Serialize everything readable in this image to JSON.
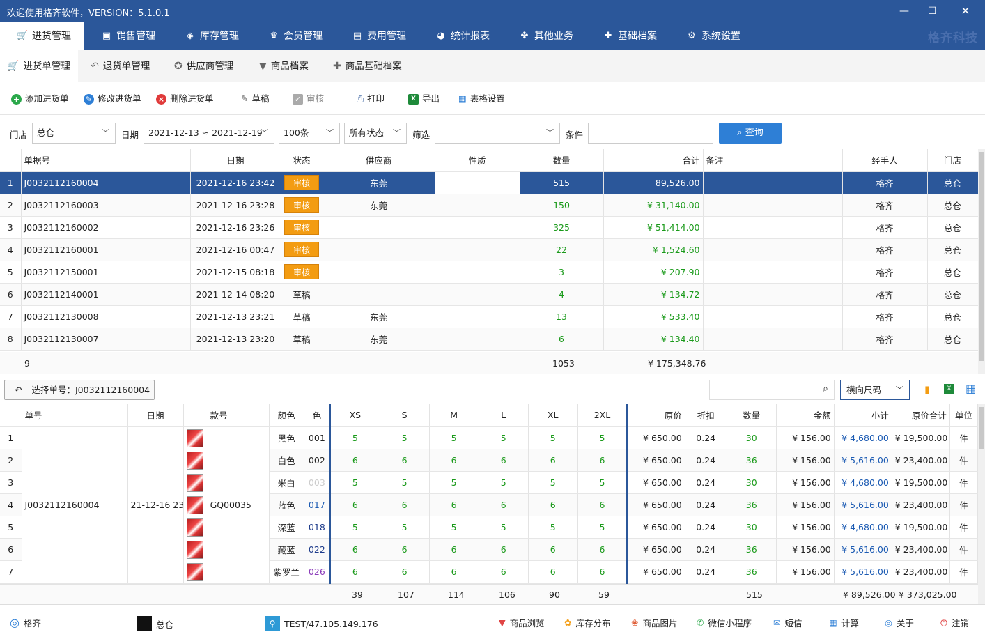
{
  "title": "欢迎使用格齐软件，VERSION：5.1.0.1",
  "brand": "格齐科技",
  "main_tabs": [
    "进货管理",
    "销售管理",
    "库存管理",
    "会员管理",
    "费用管理",
    "统计报表",
    "其他业务",
    "基础档案",
    "系统设置"
  ],
  "sub_tabs": [
    "进货单管理",
    "退货单管理",
    "供应商管理",
    "商品档案",
    "商品基础档案"
  ],
  "toolbar": [
    "添加进货单",
    "修改进货单",
    "删除进货单",
    "草稿",
    "审核",
    "打印",
    "导出",
    "表格设置"
  ],
  "filter": {
    "store_label": "门店",
    "store_value": "总仓",
    "date_label": "日期",
    "date_value": "2021-12-13 ≈ 2021-12-19",
    "count_value": "100条",
    "status_value": "所有状态",
    "screen_label": "筛选",
    "cond_label": "条件",
    "query_label": "查询"
  },
  "orders": {
    "headers": [
      "单据号",
      "日期",
      "状态",
      "供应商",
      "性质",
      "数量",
      "合计",
      "备注",
      "经手人",
      "门店"
    ],
    "rows": [
      {
        "n": "1",
        "no": "J0032112160004",
        "date": "2021-12-16 23:42",
        "status": "审核",
        "sup": "东莞",
        "qty": "515",
        "total": "89,526.00",
        "op": "格齐",
        "store": "总仓"
      },
      {
        "n": "2",
        "no": "J0032112160003",
        "date": "2021-12-16 23:28",
        "status": "审核",
        "sup": "东莞",
        "qty": "150",
        "total": "¥ 31,140.00",
        "op": "格齐",
        "store": "总仓"
      },
      {
        "n": "3",
        "no": "J0032112160002",
        "date": "2021-12-16 23:26",
        "status": "审核",
        "sup": "",
        "qty": "325",
        "total": "¥ 51,414.00",
        "op": "格齐",
        "store": "总仓"
      },
      {
        "n": "4",
        "no": "J0032112160001",
        "date": "2021-12-16 00:47",
        "status": "审核",
        "sup": "",
        "qty": "22",
        "total": "¥ 1,524.60",
        "op": "格齐",
        "store": "总仓"
      },
      {
        "n": "5",
        "no": "J0032112150001",
        "date": "2021-12-15 08:18",
        "status": "审核",
        "sup": "",
        "qty": "3",
        "total": "¥ 207.90",
        "op": "格齐",
        "store": "总仓"
      },
      {
        "n": "6",
        "no": "J0032112140001",
        "date": "2021-12-14 08:20",
        "status": "草稿",
        "sup": "",
        "qty": "4",
        "total": "¥ 134.72",
        "op": "格齐",
        "store": "总仓"
      },
      {
        "n": "7",
        "no": "J0032112130008",
        "date": "2021-12-13 23:21",
        "status": "草稿",
        "sup": "东莞",
        "qty": "13",
        "total": "¥ 533.40",
        "op": "格齐",
        "store": "总仓"
      },
      {
        "n": "8",
        "no": "J0032112130007",
        "date": "2021-12-13 23:20",
        "status": "草稿",
        "sup": "东莞",
        "qty": "6",
        "total": "¥ 134.40",
        "op": "格齐",
        "store": "总仓"
      }
    ],
    "sum": {
      "count": "9",
      "qty": "1053",
      "total": "¥ 175,348.76"
    }
  },
  "selected": {
    "label": "选择单号：J0032112160004",
    "size_mode": "横向尺码"
  },
  "detail": {
    "headers": [
      "单号",
      "日期",
      "款号",
      "颜色",
      "色",
      "XS",
      "S",
      "M",
      "L",
      "XL",
      "2XL",
      "原价",
      "折扣",
      "数量",
      "金额",
      "小计",
      "原价合计",
      "单位"
    ],
    "order_no": "J0032112160004",
    "date": "21-12-16 23:",
    "style": "GQ00035",
    "rows": [
      {
        "n": "1",
        "color": "黑色",
        "code": "001",
        "codec": "#222",
        "s": [
          "5",
          "5",
          "5",
          "5",
          "5",
          "5"
        ],
        "price": "¥ 650.00",
        "disc": "0.24",
        "qty": "30",
        "amt": "¥ 156.00",
        "sub": "¥ 4,680.00",
        "tot": "¥ 19,500.00",
        "unit": "件"
      },
      {
        "n": "2",
        "color": "白色",
        "code": "002",
        "codec": "#222",
        "s": [
          "6",
          "6",
          "6",
          "6",
          "6",
          "6"
        ],
        "price": "¥ 650.00",
        "disc": "0.24",
        "qty": "36",
        "amt": "¥ 156.00",
        "sub": "¥ 5,616.00",
        "tot": "¥ 23,400.00",
        "unit": "件"
      },
      {
        "n": "3",
        "color": "米白",
        "code": "003",
        "codec": "#ccc",
        "s": [
          "5",
          "5",
          "5",
          "5",
          "5",
          "5"
        ],
        "price": "¥ 650.00",
        "disc": "0.24",
        "qty": "30",
        "amt": "¥ 156.00",
        "sub": "¥ 4,680.00",
        "tot": "¥ 19,500.00",
        "unit": "件"
      },
      {
        "n": "4",
        "color": "蓝色",
        "code": "017",
        "codec": "#1c5bb3",
        "s": [
          "6",
          "6",
          "6",
          "6",
          "6",
          "6"
        ],
        "price": "¥ 650.00",
        "disc": "0.24",
        "qty": "36",
        "amt": "¥ 156.00",
        "sub": "¥ 5,616.00",
        "tot": "¥ 23,400.00",
        "unit": "件"
      },
      {
        "n": "5",
        "color": "深蓝",
        "code": "018",
        "codec": "#1c3a8a",
        "s": [
          "5",
          "5",
          "5",
          "5",
          "5",
          "5"
        ],
        "price": "¥ 650.00",
        "disc": "0.24",
        "qty": "30",
        "amt": "¥ 156.00",
        "sub": "¥ 4,680.00",
        "tot": "¥ 19,500.00",
        "unit": "件"
      },
      {
        "n": "6",
        "color": "藏蓝",
        "code": "022",
        "codec": "#1c3a8a",
        "s": [
          "6",
          "6",
          "6",
          "6",
          "6",
          "6"
        ],
        "price": "¥ 650.00",
        "disc": "0.24",
        "qty": "36",
        "amt": "¥ 156.00",
        "sub": "¥ 5,616.00",
        "tot": "¥ 23,400.00",
        "unit": "件"
      },
      {
        "n": "7",
        "color": "紫罗兰",
        "code": "026",
        "codec": "#8a3ab9",
        "s": [
          "6",
          "6",
          "6",
          "6",
          "6",
          "6"
        ],
        "price": "¥ 650.00",
        "disc": "0.24",
        "qty": "36",
        "amt": "¥ 156.00",
        "sub": "¥ 5,616.00",
        "tot": "¥ 23,400.00",
        "unit": "件"
      }
    ],
    "sum": {
      "sizes": [
        "39",
        "107",
        "114",
        "106",
        "90",
        "59"
      ],
      "qty": "515",
      "sub": "¥ 89,526.00",
      "tot": "¥ 373,025.00"
    }
  },
  "status": {
    "user": "格齐",
    "store": "总仓",
    "server": "TEST/47.105.149.176",
    "links": [
      "商品浏览",
      "库存分布",
      "商品图片",
      "微信小程序",
      "短信",
      "计算",
      "关于",
      "注销"
    ]
  },
  "colors": {
    "primary": "#2b579a",
    "accent": "#f39c12",
    "green": "#1a9a1a",
    "button": "#2e7fd6"
  }
}
